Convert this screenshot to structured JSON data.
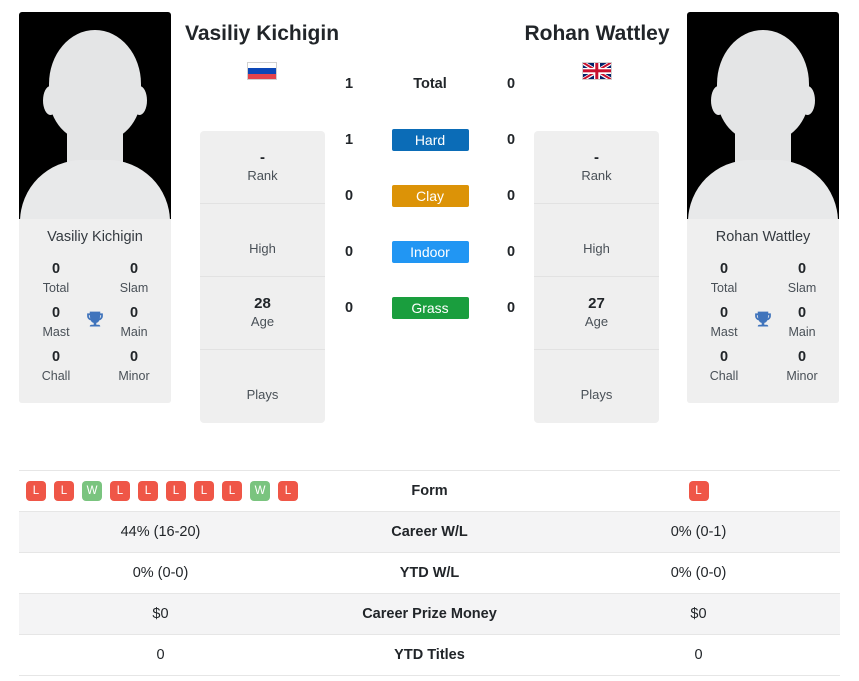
{
  "players": {
    "left": {
      "name": "Vasiliy Kichigin",
      "photo_name": "Vasiliy Kichigin",
      "flag": "ru-flag-icon",
      "info": [
        {
          "value": "-",
          "label": "Rank"
        },
        {
          "value": "",
          "label": "High"
        },
        {
          "value": "28",
          "label": "Age"
        },
        {
          "value": "",
          "label": "Plays"
        }
      ],
      "titles": {
        "total": "0",
        "slam": "0",
        "mast": "0",
        "main": "0",
        "chall": "0",
        "minor": "0"
      },
      "h2h": {
        "total": "1",
        "hard": "1",
        "clay": "0",
        "indoor": "0",
        "grass": "0"
      }
    },
    "right": {
      "name": "Rohan Wattley",
      "photo_name": "Rohan Wattley",
      "flag": "gb-flag-icon",
      "info": [
        {
          "value": "-",
          "label": "Rank"
        },
        {
          "value": "",
          "label": "High"
        },
        {
          "value": "27",
          "label": "Age"
        },
        {
          "value": "",
          "label": "Plays"
        }
      ],
      "titles": {
        "total": "0",
        "slam": "0",
        "mast": "0",
        "main": "0",
        "chall": "0",
        "minor": "0"
      },
      "h2h": {
        "total": "0",
        "hard": "0",
        "clay": "0",
        "indoor": "0",
        "grass": "0"
      }
    }
  },
  "titles_labels": {
    "total": "Total",
    "slam": "Slam",
    "mast": "Mast",
    "main": "Main",
    "chall": "Chall",
    "minor": "Minor"
  },
  "surfaces": {
    "total_label": "Total",
    "hard_label": "Hard",
    "clay_label": "Clay",
    "indoor_label": "Indoor",
    "grass_label": "Grass"
  },
  "colors": {
    "hard": "#0b6cb7",
    "clay": "#dc9307",
    "indoor": "#2196f3",
    "grass": "#1a9e3e",
    "win": "#7ac47f",
    "loss": "#ef5647",
    "trophy": "#4074bc"
  },
  "table": {
    "rows": [
      {
        "label": "Form",
        "type": "form",
        "left_forms": [
          "L",
          "L",
          "W",
          "L",
          "L",
          "L",
          "L",
          "L",
          "W",
          "L"
        ],
        "right_forms": [
          "L"
        ]
      },
      {
        "label": "Career W/L",
        "type": "text",
        "left": "44% (16-20)",
        "right": "0% (0-1)"
      },
      {
        "label": "YTD W/L",
        "type": "text",
        "left": "0% (0-0)",
        "right": "0% (0-0)"
      },
      {
        "label": "Career Prize Money",
        "type": "text",
        "left": "$0",
        "right": "$0"
      },
      {
        "label": "YTD Titles",
        "type": "text",
        "left": "0",
        "right": "0"
      }
    ]
  },
  "icons": {
    "trophy": "trophy-icon"
  }
}
